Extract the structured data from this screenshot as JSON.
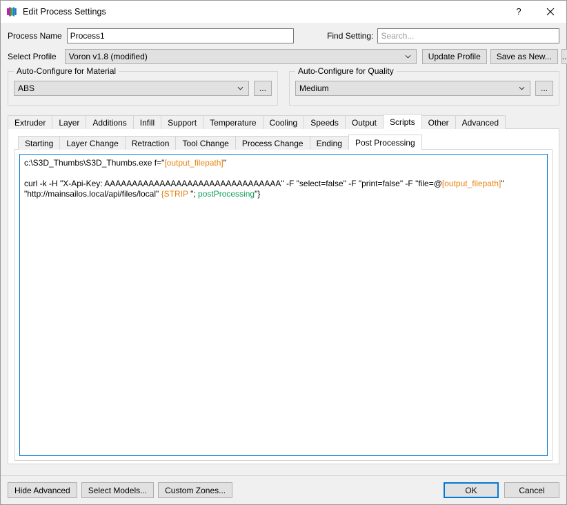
{
  "window": {
    "title": "Edit Process Settings",
    "icon": "simplify3d-bars-icon",
    "help_label": "?",
    "close_label": "✕",
    "accent_color": "#0078d7"
  },
  "header": {
    "process_name_label": "Process Name",
    "process_name_value": "Process1",
    "find_setting_label": "Find Setting:",
    "find_setting_value": "",
    "find_setting_placeholder": "Search...",
    "select_profile_label": "Select Profile",
    "select_profile_value": "Voron v1.8 (modified)",
    "update_profile_label": "Update Profile",
    "save_as_new_label": "Save as New...",
    "profile_ellipsis_label": "..."
  },
  "material_group": {
    "title": "Auto-Configure for Material",
    "value": "ABS",
    "ellipsis_label": "..."
  },
  "quality_group": {
    "title": "Auto-Configure for Quality",
    "value": "Medium",
    "ellipsis_label": "..."
  },
  "main_tabs": {
    "active": "Scripts",
    "items": [
      {
        "label": "Extruder"
      },
      {
        "label": "Layer"
      },
      {
        "label": "Additions"
      },
      {
        "label": "Infill"
      },
      {
        "label": "Support"
      },
      {
        "label": "Temperature"
      },
      {
        "label": "Cooling"
      },
      {
        "label": "Speeds"
      },
      {
        "label": "Output"
      },
      {
        "label": "Scripts"
      },
      {
        "label": "Other"
      },
      {
        "label": "Advanced"
      }
    ]
  },
  "sub_tabs": {
    "active": "Post Processing",
    "items": [
      {
        "label": "Starting"
      },
      {
        "label": "Layer Change"
      },
      {
        "label": "Retraction"
      },
      {
        "label": "Tool Change"
      },
      {
        "label": "Process Change"
      },
      {
        "label": "Ending"
      },
      {
        "label": "Post Processing"
      }
    ]
  },
  "script": {
    "colors": {
      "variable": "#e8820c",
      "keyword": "#0f9d58"
    },
    "lines": [
      {
        "tokens": [
          {
            "text": "c:\\S3D_Thumbs\\S3D_Thumbs.exe f=\"",
            "style": "plain"
          },
          {
            "text": "[output_filepath]",
            "style": "orange"
          },
          {
            "text": "\"",
            "style": "plain"
          }
        ]
      },
      {
        "blank": true
      },
      {
        "tokens": [
          {
            "text": "curl -k -H \"X-Api-Key: AAAAAAAAAAAAAAAAAAAAAAAAAAAAAAAA\" -F \"select=false\" -F \"print=false\" -F \"file=@",
            "style": "plain"
          },
          {
            "text": "[output_filepath]",
            "style": "orange"
          },
          {
            "text": "\" \"http://mainsailos.local/api/files/local\" ",
            "style": "plain"
          },
          {
            "text": "{STRIP",
            "style": "orange"
          },
          {
            "text": " \"; ",
            "style": "plain"
          },
          {
            "text": "postProcessing",
            "style": "green"
          },
          {
            "text": "\"}",
            "style": "plain"
          }
        ]
      }
    ]
  },
  "footer": {
    "hide_advanced_label": "Hide Advanced",
    "select_models_label": "Select Models...",
    "custom_zones_label": "Custom Zones...",
    "ok_label": "OK",
    "cancel_label": "Cancel"
  }
}
